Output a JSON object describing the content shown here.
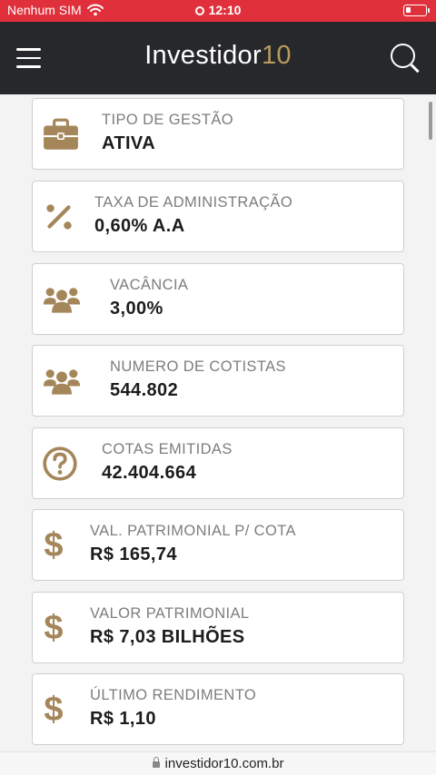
{
  "status_bar": {
    "carrier": "Nenhum SIM",
    "time": "12:10",
    "accent_color": "#e0303b"
  },
  "header": {
    "logo_text": "Investidor",
    "logo_suffix": "10",
    "menu_icon": "hamburger-icon",
    "search_icon": "search-icon",
    "background": "#26282b",
    "accent_color": "#b99a5f"
  },
  "cards": [
    {
      "icon": "briefcase-icon",
      "label": "TIPO DE GESTÃO",
      "value": "ATIVA"
    },
    {
      "icon": "percent-icon",
      "label": "TAXA DE ADMINISTRAÇÃO",
      "value": "0,60% A.A"
    },
    {
      "icon": "users-icon",
      "label": "VACÂNCIA",
      "value": "3,00%"
    },
    {
      "icon": "users-icon",
      "label": "NUMERO DE COTISTAS",
      "value": "544.802"
    },
    {
      "icon": "question-circle-icon",
      "label": "COTAS EMITIDAS",
      "value": "42.404.664"
    },
    {
      "icon": "dollar-icon",
      "label": "VAL. PATRIMONIAL P/ COTA",
      "value": "R$ 165,74"
    },
    {
      "icon": "dollar-icon",
      "label": "VALOR PATRIMONIAL",
      "value": "R$ 7,03 BILHÕES"
    },
    {
      "icon": "dollar-icon",
      "label": "ÚLTIMO RENDIMENTO",
      "value": "R$ 1,10"
    }
  ],
  "url_bar": {
    "url": "investidor10.com.br"
  }
}
